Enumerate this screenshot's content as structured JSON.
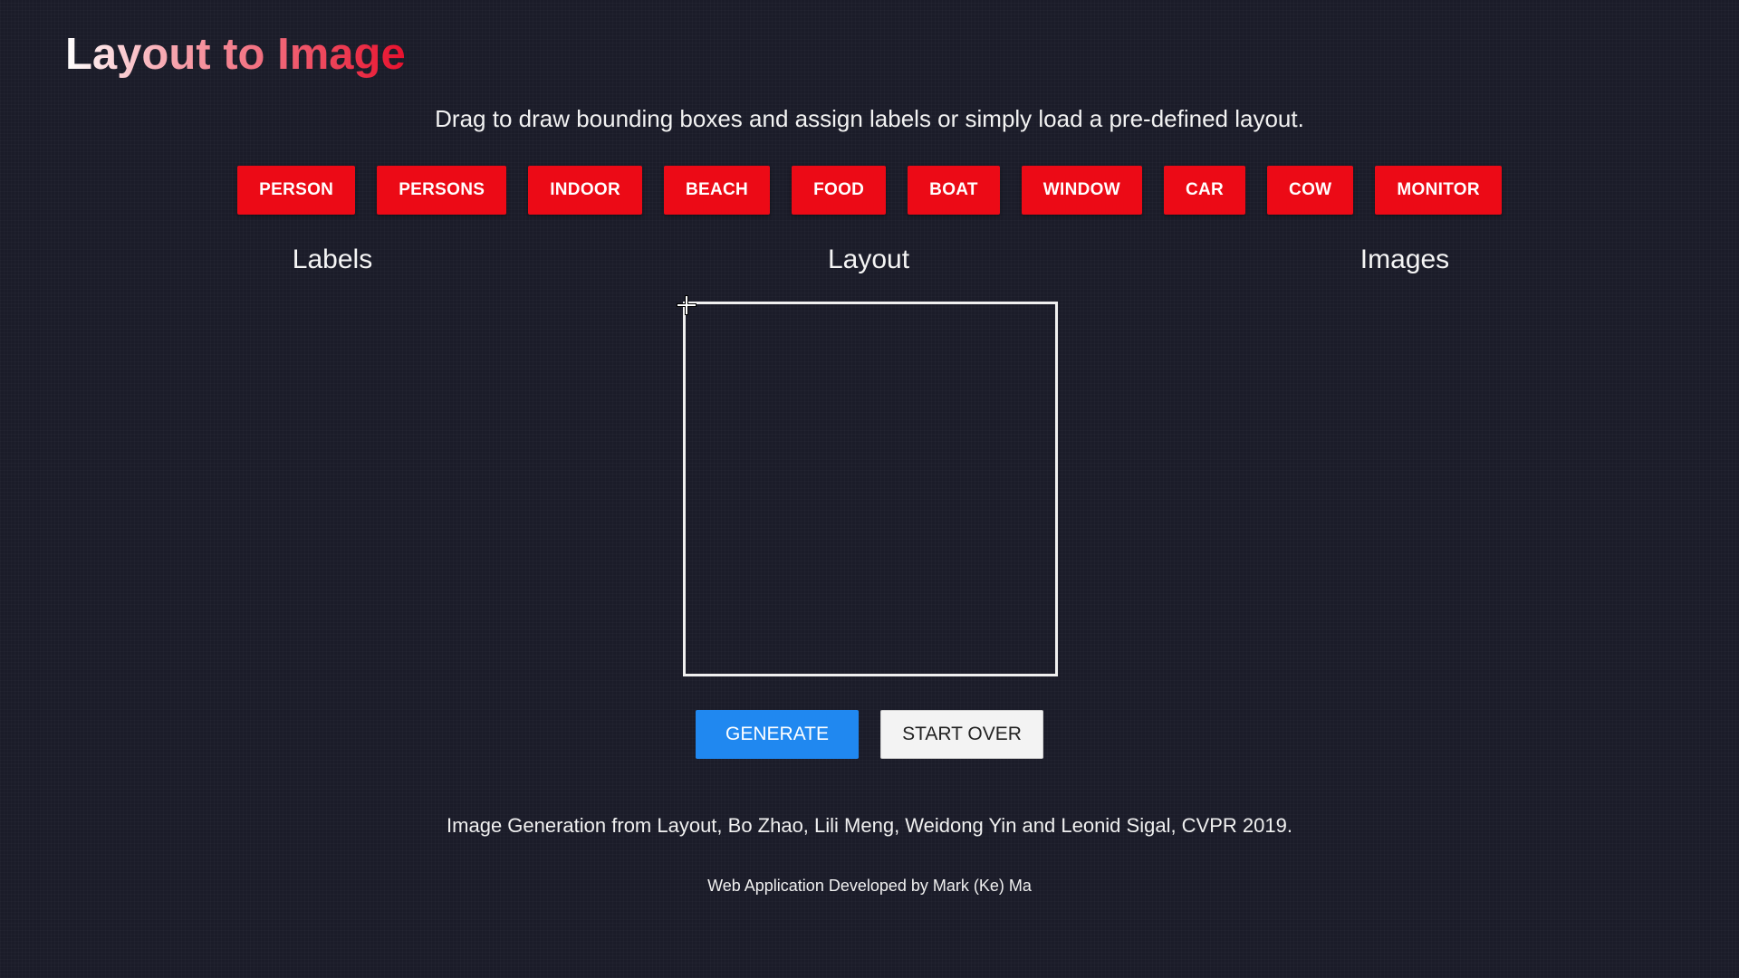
{
  "header": {
    "title": "Layout to Image",
    "instructions": "Drag to draw bounding boxes and assign labels or simply load a pre-defined layout."
  },
  "presets": [
    {
      "label": "PERSON"
    },
    {
      "label": "PERSONS"
    },
    {
      "label": "INDOOR"
    },
    {
      "label": "BEACH"
    },
    {
      "label": "FOOD"
    },
    {
      "label": "BOAT"
    },
    {
      "label": "WINDOW"
    },
    {
      "label": "CAR"
    },
    {
      "label": "COW"
    },
    {
      "label": "MONITOR"
    }
  ],
  "columns": {
    "labels": "Labels",
    "layout": "Layout",
    "images": "Images"
  },
  "actions": {
    "generate": "GENERATE",
    "start_over": "START OVER"
  },
  "footer": {
    "citation": "Image Generation from Layout, Bo Zhao, Lili Meng, Weidong Yin and Leonid Sigal, CVPR 2019.",
    "credit": "Web Application Developed by Mark (Ke) Ma"
  },
  "colors": {
    "background": "#1b1c29",
    "preset_button": "#ec0a16",
    "generate_button": "#2088f0",
    "start_over_button": "#f3f3f3",
    "title_gradient_end": "#e8112d"
  },
  "icons": {
    "cursor": "crosshair-cursor-icon"
  }
}
